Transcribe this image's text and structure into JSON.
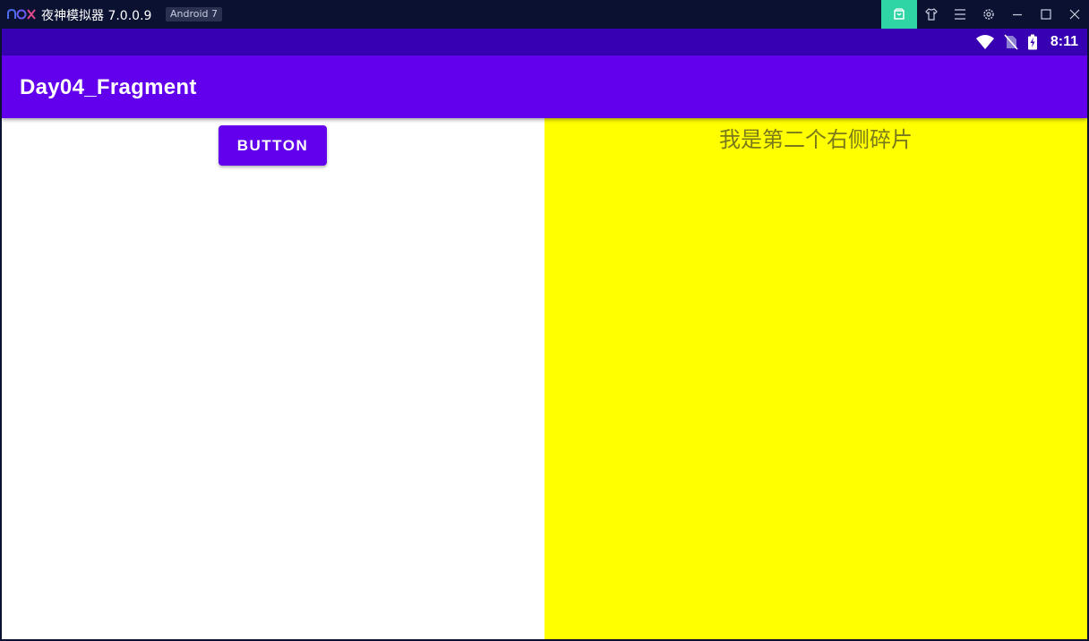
{
  "emulator": {
    "title": "夜神模拟器 7.0.0.9",
    "android_badge": "Android 7",
    "toolbar_icons": [
      "store-icon",
      "shirt-icon",
      "menu-icon",
      "settings-icon",
      "minimize-icon",
      "maximize-icon",
      "close-icon"
    ],
    "accent_color": "#2fd5a4",
    "background_color": "#0b1130"
  },
  "statusbar": {
    "time": "8:11",
    "icons": [
      "wifi-icon",
      "no-sim-icon",
      "battery-charging-icon"
    ],
    "color": "#3700b3"
  },
  "app": {
    "title": "Day04_Fragment",
    "primary_color": "#6200ee"
  },
  "left_fragment": {
    "button_label": "BUTTON"
  },
  "right_fragment": {
    "text": "我是第二个右侧碎片",
    "background_color": "#ffff00"
  }
}
